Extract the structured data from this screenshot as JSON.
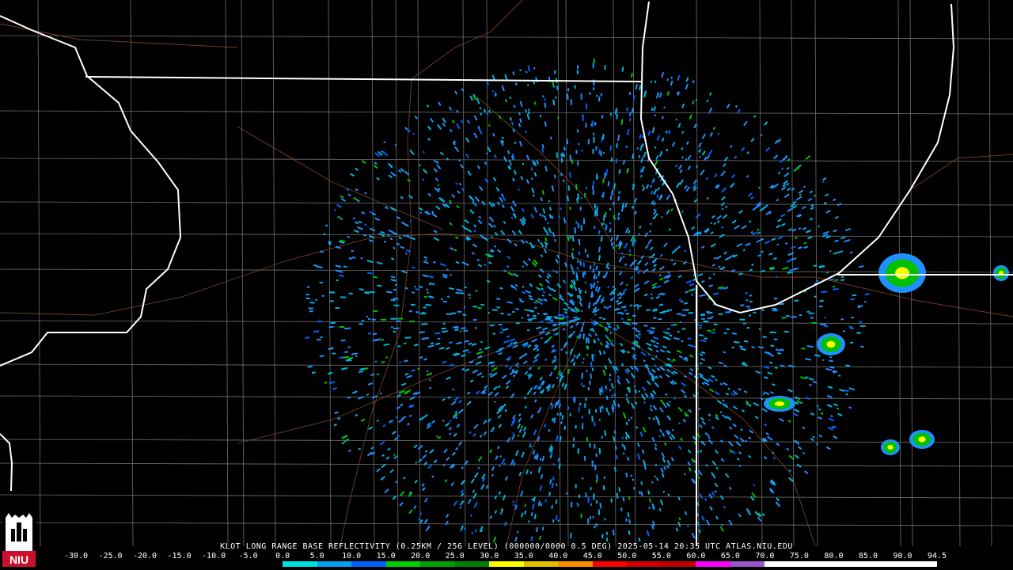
{
  "product": {
    "title": "KLOT LONG RANGE BASE REFLECTIVITY (0.25KM / 256 LEVEL) (000000/0000 0.5 DEG) 2025-05-14 20:35 UTC  ATLAS.NIU.EDU"
  },
  "logo": {
    "text": "NIU"
  },
  "legend": {
    "labels": [
      "-30.0",
      "-25.0",
      "-20.0",
      "-15.0",
      "-10.0",
      "-5.0",
      "0.0",
      "5.0",
      "10.0",
      "15.0",
      "20.0",
      "25.0",
      "30.0",
      "35.0",
      "40.0",
      "45.0",
      "50.0",
      "55.0",
      "60.0",
      "65.0",
      "70.0",
      "75.0",
      "80.0",
      "85.0",
      "90.0",
      "94.5"
    ],
    "colors": [
      "#000000",
      "#000000",
      "#000000",
      "#000000",
      "#000000",
      "#000000",
      "#00e0e0",
      "#00a0f0",
      "#0060ff",
      "#00d000",
      "#00a000",
      "#008000",
      "#ffff00",
      "#e0c000",
      "#ff9000",
      "#ff0000",
      "#d00000",
      "#c00000",
      "#ff00ff",
      "#9955c9",
      "#ffffff",
      "#ffffff",
      "#ffffff",
      "#ffffff",
      "#ffffff"
    ]
  },
  "map": {
    "radar_site": "KLOT",
    "colors": {
      "state_lines": "#ffffff",
      "county_lines": "#8c8c8c",
      "roads": "#8b4a2a",
      "echo_weak": "#1e90ff",
      "echo_mod": "#00c000",
      "echo_strong": "#ffff00"
    }
  }
}
